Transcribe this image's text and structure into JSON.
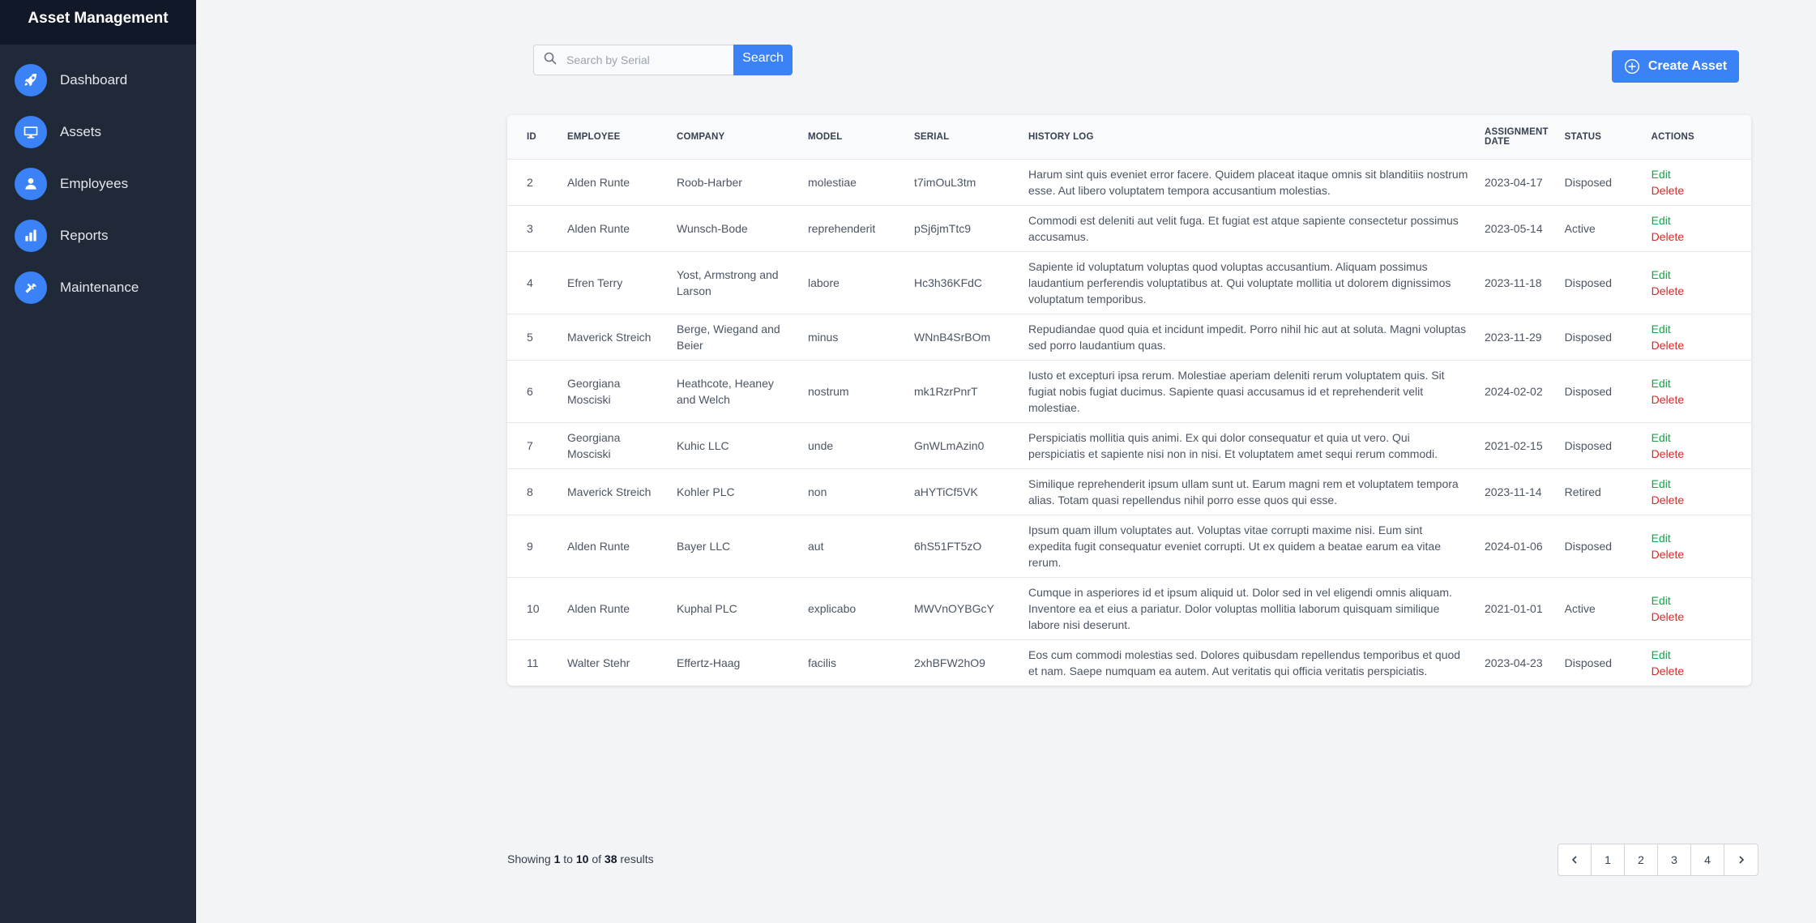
{
  "app": {
    "title": "Asset Management"
  },
  "sidebar": {
    "items": [
      {
        "label": "Dashboard",
        "icon": "rocket-icon"
      },
      {
        "label": "Assets",
        "icon": "monitor-icon"
      },
      {
        "label": "Employees",
        "icon": "user-icon"
      },
      {
        "label": "Reports",
        "icon": "bar-chart-icon"
      },
      {
        "label": "Maintenance",
        "icon": "tools-icon"
      }
    ]
  },
  "search": {
    "placeholder": "Search by Serial",
    "value": "",
    "button_label": "Search"
  },
  "create_button": {
    "label": "Create Asset"
  },
  "table": {
    "columns": [
      "ID",
      "EMPLOYEE",
      "COMPANY",
      "MODEL",
      "SERIAL",
      "HISTORY LOG",
      "ASSIGNMENT DATE",
      "STATUS",
      "ACTIONS"
    ],
    "edit_label": "Edit",
    "delete_label": "Delete",
    "rows": [
      {
        "id": "2",
        "employee": "Alden Runte",
        "company": "Roob-Harber",
        "model": "molestiae",
        "serial": "t7imOuL3tm",
        "history": "Harum sint quis eveniet error facere. Quidem placeat itaque omnis sit blanditiis nostrum esse. Aut libero voluptatem tempora accusantium molestias.",
        "date": "2023-04-17",
        "status": "Disposed"
      },
      {
        "id": "3",
        "employee": "Alden Runte",
        "company": "Wunsch-Bode",
        "model": "reprehenderit",
        "serial": "pSj6jmTtc9",
        "history": "Commodi est deleniti aut velit fuga. Et fugiat est atque sapiente consectetur possimus accusamus.",
        "date": "2023-05-14",
        "status": "Active"
      },
      {
        "id": "4",
        "employee": "Efren Terry",
        "company": "Yost, Armstrong and Larson",
        "model": "labore",
        "serial": "Hc3h36KFdC",
        "history": "Sapiente id voluptatum voluptas quod voluptas accusantium. Aliquam possimus laudantium perferendis voluptatibus at. Qui voluptate mollitia ut dolorem dignissimos voluptatum temporibus.",
        "date": "2023-11-18",
        "status": "Disposed"
      },
      {
        "id": "5",
        "employee": "Maverick Streich",
        "company": "Berge, Wiegand and Beier",
        "model": "minus",
        "serial": "WNnB4SrBOm",
        "history": "Repudiandae quod quia et incidunt impedit. Porro nihil hic aut at soluta. Magni voluptas sed porro laudantium quas.",
        "date": "2023-11-29",
        "status": "Disposed"
      },
      {
        "id": "6",
        "employee": "Georgiana Mosciski",
        "company": "Heathcote, Heaney and Welch",
        "model": "nostrum",
        "serial": "mk1RzrPnrT",
        "history": "Iusto et excepturi ipsa rerum. Molestiae aperiam deleniti rerum voluptatem quis. Sit fugiat nobis fugiat ducimus. Sapiente quasi accusamus id et reprehenderit velit molestiae.",
        "date": "2024-02-02",
        "status": "Disposed"
      },
      {
        "id": "7",
        "employee": "Georgiana Mosciski",
        "company": "Kuhic LLC",
        "model": "unde",
        "serial": "GnWLmAzin0",
        "history": "Perspiciatis mollitia quis animi. Ex qui dolor consequatur et quia ut vero. Qui perspiciatis et sapiente nisi non in nisi. Et voluptatem amet sequi rerum commodi.",
        "date": "2021-02-15",
        "status": "Disposed"
      },
      {
        "id": "8",
        "employee": "Maverick Streich",
        "company": "Kohler PLC",
        "model": "non",
        "serial": "aHYTiCf5VK",
        "history": "Similique reprehenderit ipsum ullam sunt ut. Earum magni rem et voluptatem tempora alias. Totam quasi repellendus nihil porro esse quos qui esse.",
        "date": "2023-11-14",
        "status": "Retired"
      },
      {
        "id": "9",
        "employee": "Alden Runte",
        "company": "Bayer LLC",
        "model": "aut",
        "serial": "6hS51FT5zO",
        "history": "Ipsum quam illum voluptates aut. Voluptas vitae corrupti maxime nisi. Eum sint expedita fugit consequatur eveniet corrupti. Ut ex quidem a beatae earum ea vitae rerum.",
        "date": "2024-01-06",
        "status": "Disposed"
      },
      {
        "id": "10",
        "employee": "Alden Runte",
        "company": "Kuphal PLC",
        "model": "explicabo",
        "serial": "MWVnOYBGcY",
        "history": "Cumque in asperiores id et ipsum aliquid ut. Dolor sed in vel eligendi omnis aliquam. Inventore ea et eius a pariatur. Dolor voluptas mollitia laborum quisquam similique labore nisi deserunt.",
        "date": "2021-01-01",
        "status": "Active"
      },
      {
        "id": "11",
        "employee": "Walter Stehr",
        "company": "Effertz-Haag",
        "model": "facilis",
        "serial": "2xhBFW2hO9",
        "history": "Eos cum commodi molestias sed. Dolores quibusdam repellendus temporibus et quod et nam. Saepe numquam ea autem. Aut veritatis qui officia veritatis perspiciatis.",
        "date": "2023-04-23",
        "status": "Disposed"
      }
    ]
  },
  "pagination": {
    "showing_prefix": "Showing",
    "from": "1",
    "to_word": "to",
    "to": "10",
    "of_word": "of",
    "total": "38",
    "suffix": "results",
    "pages": [
      "1",
      "2",
      "3",
      "4"
    ]
  },
  "colors": {
    "sidebar_bg": "#1f2937",
    "brand_bg": "#111827",
    "accent": "#3b82f6",
    "edit": "#16a34a",
    "delete": "#dc2626"
  }
}
